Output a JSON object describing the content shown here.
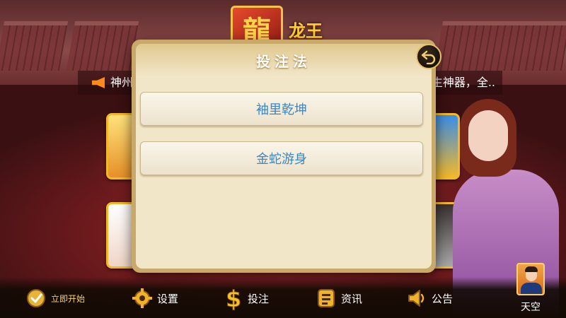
{
  "app": {
    "logo_text": "龙王"
  },
  "marquee": {
    "left_text": "神州朋",
    "right_text": "生神器，全.."
  },
  "dialog": {
    "title": "投注法",
    "options": [
      {
        "label": "袖里乾坤"
      },
      {
        "label": "金蛇游身"
      }
    ]
  },
  "icons": {
    "back": "back-arrow-icon",
    "start": "check-circle-icon",
    "settings": "gear-icon",
    "bet": "dollar-icon",
    "news": "news-icon",
    "notice": "speaker-icon"
  },
  "bottom_nav": {
    "start_label": "立即开始",
    "settings_label": "设置",
    "bet_label": "投注",
    "news_label": "资讯",
    "notice_label": "公告"
  },
  "user": {
    "name": "天空"
  },
  "colors": {
    "dialog_bg": "#f2e6c8",
    "dialog_border": "#c9a96a",
    "option_text": "#3b86c4",
    "accent_gold": "#ffcf3a"
  }
}
